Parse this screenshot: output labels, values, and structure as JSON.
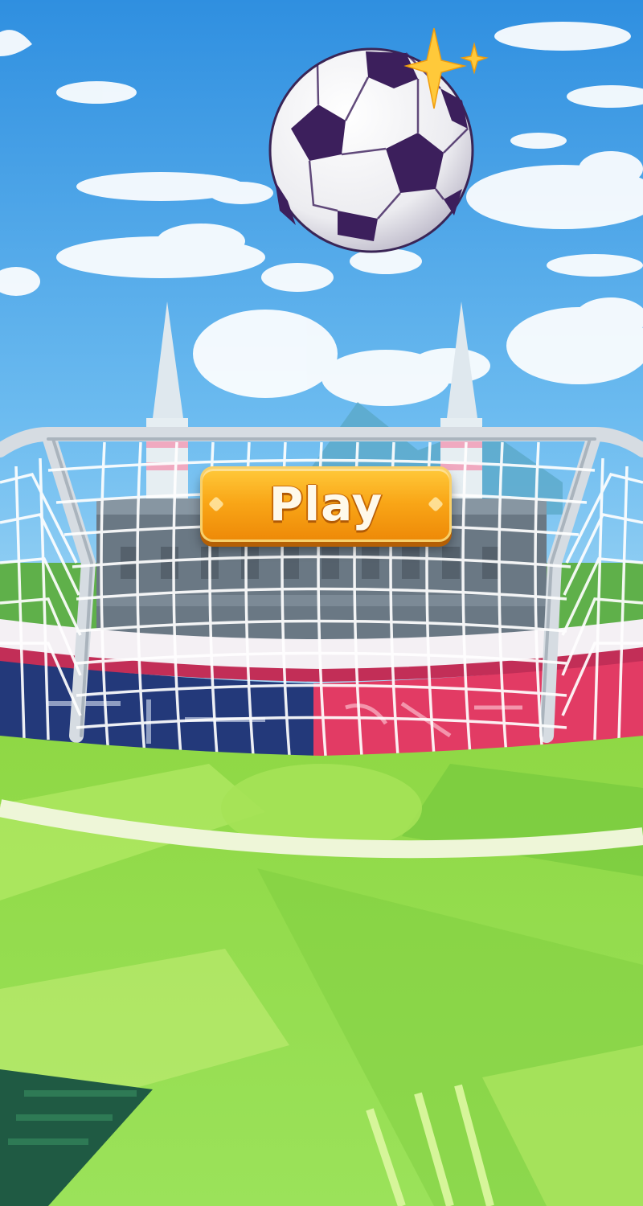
{
  "play_button": {
    "label": "Play"
  },
  "colors": {
    "sky": "#4aa3e8",
    "grass": "#a8e65a",
    "button": "#f9a617",
    "ball_patch": "#3c1f5c"
  },
  "icons": [
    "soccer-ball-icon",
    "sparkle-icon"
  ]
}
